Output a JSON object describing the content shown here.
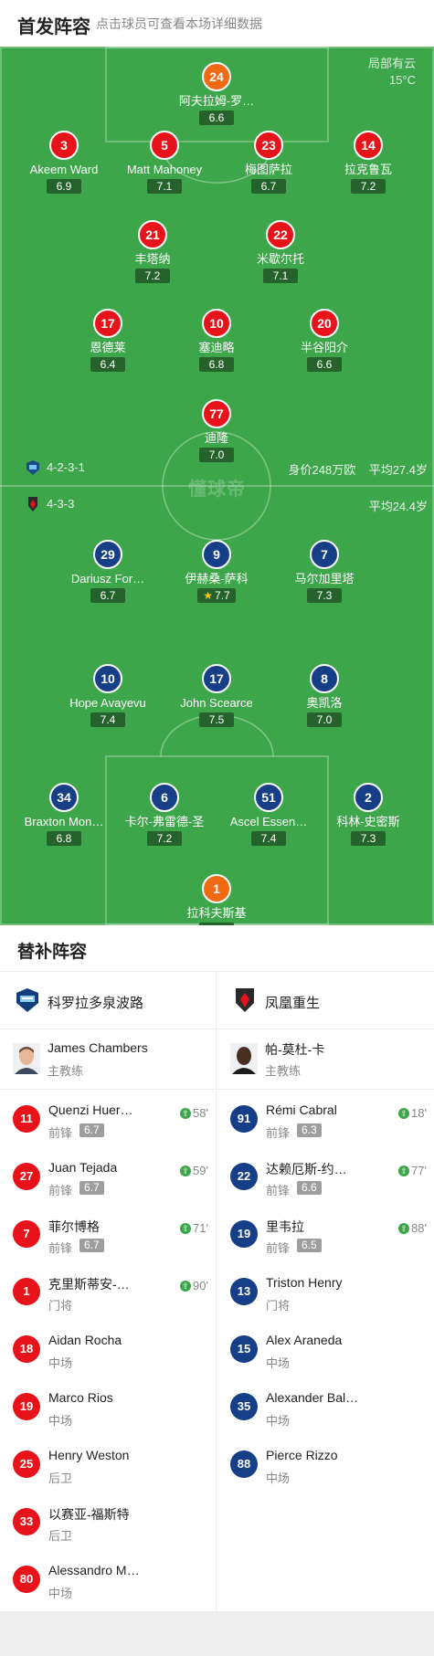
{
  "header": {
    "title": "首发阵容",
    "subtitle": "点击球员可查看本场详细数据"
  },
  "weather": {
    "condition": "局部有云",
    "temp": "15°C"
  },
  "watermark": "懂球帝",
  "home_team": {
    "formation": "4-2-3-1",
    "value": "身价248万欧",
    "avg_age": "平均27.4岁",
    "color": "#e8131a"
  },
  "away_team": {
    "formation": "4-3-3",
    "avg_age": "平均24.4岁",
    "color": "#163f88"
  },
  "home_players": [
    {
      "num": "24",
      "name": "阿夫拉姆-罗…",
      "rating": "6.6",
      "gk": true,
      "red": true
    },
    {
      "num": "3",
      "name": "Akeem Ward",
      "rating": "6.9"
    },
    {
      "num": "5",
      "name": "Matt Mahoney",
      "rating": "7.1",
      "captain": true
    },
    {
      "num": "23",
      "name": "梅图萨拉",
      "rating": "6.7"
    },
    {
      "num": "14",
      "name": "拉克鲁瓦",
      "rating": "7.2"
    },
    {
      "num": "21",
      "name": "丰塔纳",
      "rating": "7.2",
      "yellow": true,
      "sub": "58'",
      "goal": true
    },
    {
      "num": "22",
      "name": "米歇尔托",
      "rating": "7.1",
      "sub": "90'"
    },
    {
      "num": "17",
      "name": "恩德莱",
      "rating": "6.4",
      "sub": "71'"
    },
    {
      "num": "10",
      "name": "塞迪略",
      "rating": "6.8"
    },
    {
      "num": "20",
      "name": "半谷阳介",
      "rating": "6.6",
      "sub": "59'",
      "assist": true
    },
    {
      "num": "77",
      "name": "迪隆",
      "rating": "7.0"
    }
  ],
  "away_players": [
    {
      "num": "29",
      "name": "Dariusz For…",
      "rating": "6.7",
      "sub": "88'"
    },
    {
      "num": "9",
      "name": "伊赫桑-萨科",
      "rating": "7.7",
      "star": true,
      "assist": true
    },
    {
      "num": "7",
      "name": "马尔加里塔",
      "rating": "7.3",
      "sub": "18'",
      "goal": true
    },
    {
      "num": "10",
      "name": "Hope Avayevu",
      "rating": "7.4",
      "yellow": true,
      "sub": "77'"
    },
    {
      "num": "17",
      "name": "John Scearce",
      "rating": "7.5"
    },
    {
      "num": "8",
      "name": "奥凯洛",
      "rating": "7.0"
    },
    {
      "num": "34",
      "name": "Braxton Mon…",
      "rating": "6.8"
    },
    {
      "num": "6",
      "name": "卡尔-弗雷德-圣",
      "rating": "7.2",
      "captain": true
    },
    {
      "num": "51",
      "name": "Ascel Essen…",
      "rating": "7.4"
    },
    {
      "num": "2",
      "name": "科林-史密斯",
      "rating": "7.3"
    },
    {
      "num": "1",
      "name": "拉科夫斯基",
      "rating": "6.8",
      "gk": true
    }
  ],
  "subs": {
    "title": "替补阵容",
    "home": {
      "team": "科罗拉多泉波路",
      "coach": {
        "name": "James Chambers",
        "role": "主教练"
      },
      "players": [
        {
          "num": "11",
          "name": "Quenzi Huer…",
          "pos": "前锋",
          "rating": "6.7",
          "time": "58'"
        },
        {
          "num": "27",
          "name": "Juan Tejada",
          "pos": "前锋",
          "rating": "6.7",
          "time": "59'"
        },
        {
          "num": "7",
          "name": "菲尔博格",
          "pos": "前锋",
          "rating": "6.7",
          "time": "71'"
        },
        {
          "num": "1",
          "name": "克里斯蒂安-…",
          "pos": "门将",
          "rating": "",
          "time": "90'"
        },
        {
          "num": "18",
          "name": "Aidan Rocha",
          "pos": "中场",
          "rating": "",
          "time": ""
        },
        {
          "num": "19",
          "name": "Marco Rios",
          "pos": "中场",
          "rating": "",
          "time": ""
        },
        {
          "num": "25",
          "name": "Henry Weston",
          "pos": "后卫",
          "rating": "",
          "time": ""
        },
        {
          "num": "33",
          "name": "以赛亚-福斯特",
          "pos": "后卫",
          "rating": "",
          "time": ""
        },
        {
          "num": "80",
          "name": "Alessandro M…",
          "pos": "中场",
          "rating": "",
          "time": ""
        }
      ]
    },
    "away": {
      "team": "凤凰重生",
      "coach": {
        "name": "帕-莫杜-卡",
        "role": "主教练"
      },
      "players": [
        {
          "num": "91",
          "name": "Rémi Cabral",
          "pos": "前锋",
          "rating": "6.3",
          "time": "18'"
        },
        {
          "num": "22",
          "name": "达赖厄斯-约…",
          "pos": "前锋",
          "rating": "6.6",
          "time": "77'"
        },
        {
          "num": "19",
          "name": "里韦拉",
          "pos": "前锋",
          "rating": "6.5",
          "time": "88'"
        },
        {
          "num": "13",
          "name": "Triston Henry",
          "pos": "门将",
          "rating": "",
          "time": ""
        },
        {
          "num": "15",
          "name": "Alex Araneda",
          "pos": "中场",
          "rating": "",
          "time": ""
        },
        {
          "num": "35",
          "name": "Alexander Bal…",
          "pos": "中场",
          "rating": "",
          "time": ""
        },
        {
          "num": "88",
          "name": "Pierce Rizzo",
          "pos": "中场",
          "rating": "",
          "time": ""
        }
      ]
    }
  }
}
